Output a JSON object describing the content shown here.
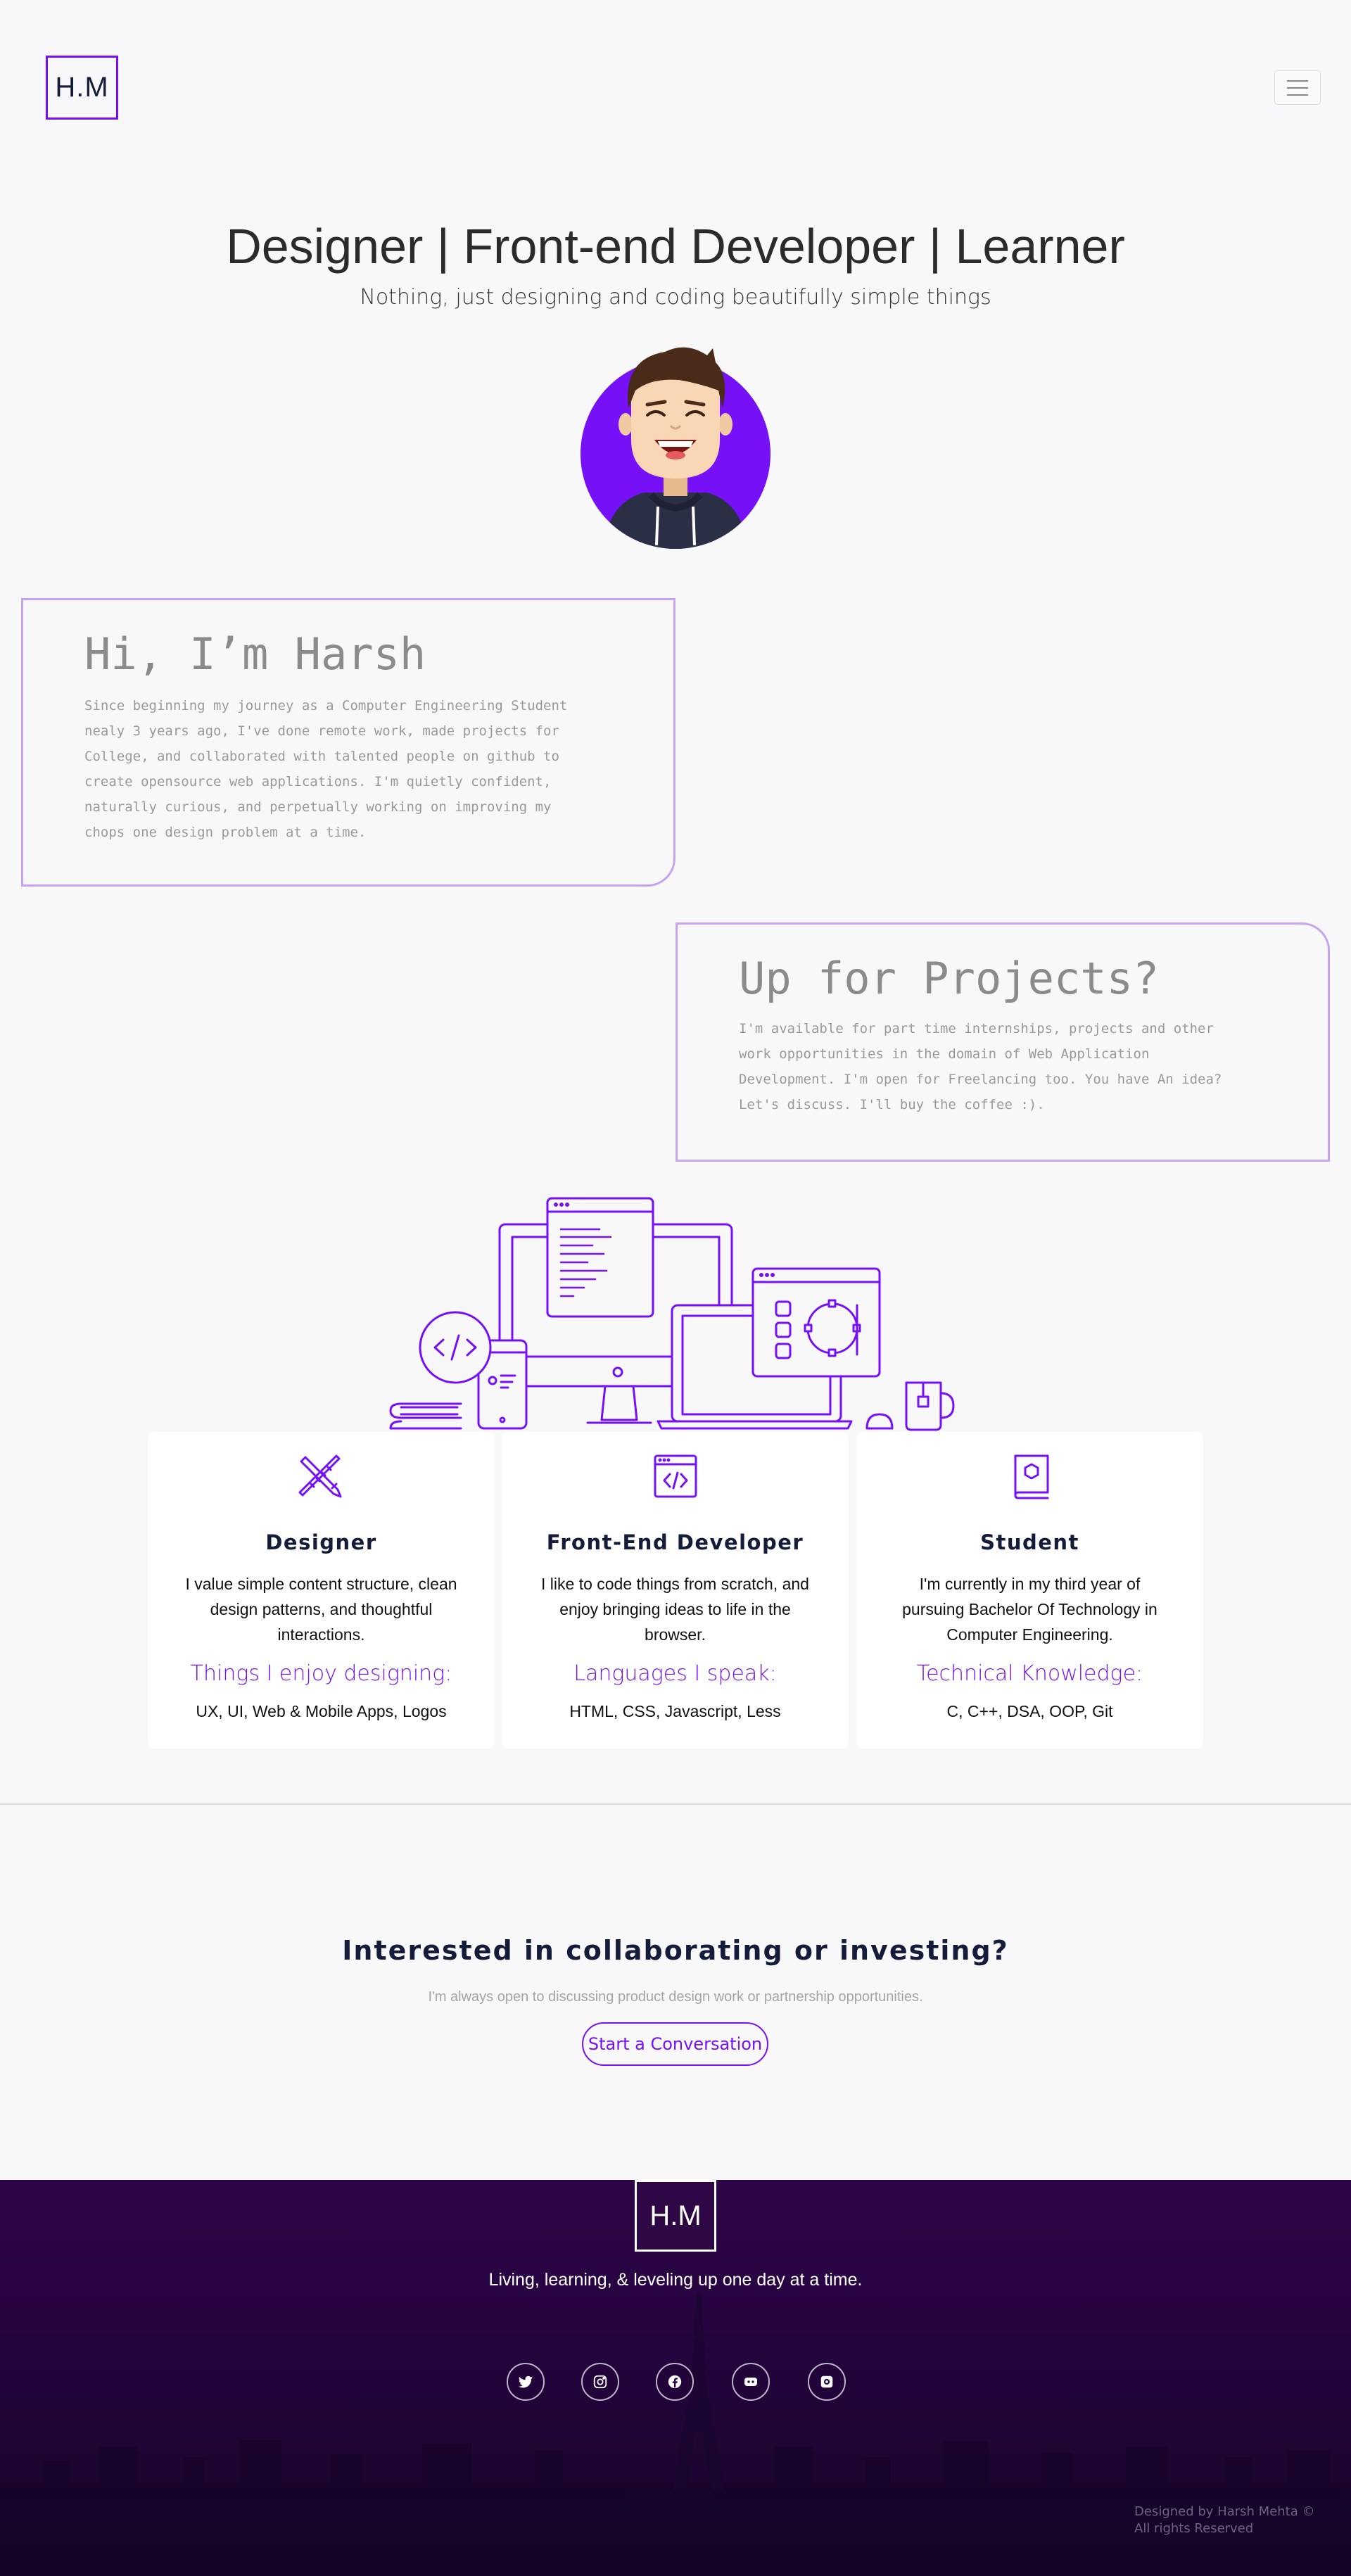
{
  "header": {
    "logo": "H.M",
    "menu_icon": "hamburger-menu-icon"
  },
  "hero": {
    "title": "Designer | Front-end Developer | Learner",
    "subtitle": "Nothing, just designing and coding beautifully simple things",
    "avatar_icon": "avatar-illustration"
  },
  "about": {
    "title": "Hi, I’m Harsh",
    "lines": [
      "Since beginning my journey as a Computer Engineering Student",
      "nealy 3 years ago, I've done remote work, made projects for",
      "College, and collaborated with talented people on github to",
      "create opensource web applications. I'm quietly confident,",
      "naturally curious, and perpetually working on improving my",
      "chops one design problem at a time."
    ]
  },
  "projects": {
    "title": "Up for Projects?",
    "lines": [
      "I'm available for part time internships, projects and other",
      "work opportunities in the domain of Web Application",
      "Development. I'm open for Freelancing too. You have An idea?",
      "Let's discuss. I'll buy the coffee :)."
    ]
  },
  "skills": [
    {
      "icon": "pencil-ruler-icon",
      "title": "Designer",
      "desc": "I value simple content structure, clean design patterns, and thoughtful interactions.",
      "sub": "Things I enjoy designing:",
      "list": "UX, UI, Web & Mobile Apps, Logos"
    },
    {
      "icon": "code-window-icon",
      "title": "Front-End Developer",
      "desc": "I like to code things from scratch, and enjoy bringing ideas to life in the browser.",
      "sub": "Languages I speak:",
      "list": "HTML, CSS, Javascript, Less"
    },
    {
      "icon": "book-icon",
      "title": "Student",
      "desc": "I'm currently in my third year of pursuing Bachelor Of Technology in Computer Engineering.",
      "sub": "Technical Knowledge:",
      "list": "C, C++, DSA, OOP, Git"
    }
  ],
  "cta": {
    "title": "Interested in collaborating or investing?",
    "text": "I'm always open to discussing product design work or partnership opportunities.",
    "button": "Start a Conversation"
  },
  "footer": {
    "logo": "H.M",
    "tagline": "Living, learning, & leveling up one day at a time.",
    "social": [
      "twitter-icon",
      "instagram-icon",
      "facebook-icon",
      "discord-icon",
      "github-icon"
    ],
    "copyright_line1": "Designed by Harsh Mehta ©",
    "copyright_line2": "All rights Reserved"
  },
  "colors": {
    "accent": "#7510f7",
    "card_border": "#c5a3f0",
    "footer_bg": "#2e0547"
  }
}
